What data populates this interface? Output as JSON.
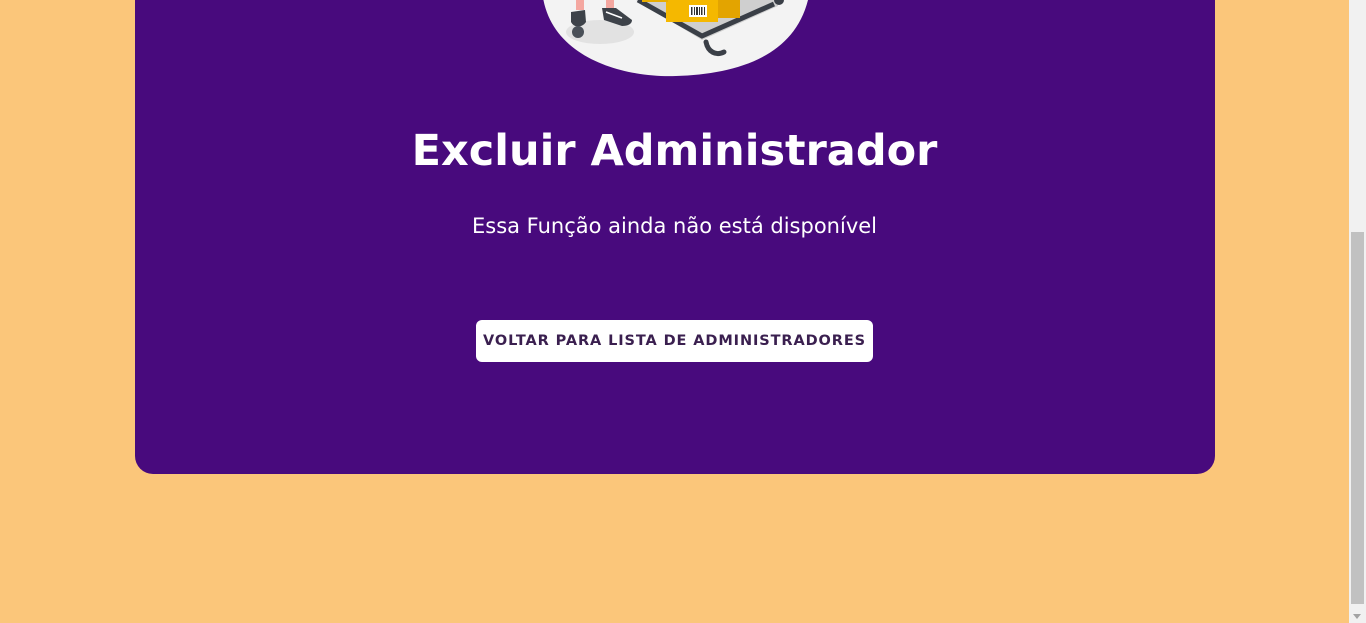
{
  "page": {
    "title": "Excluir Administrador",
    "subtitle": "Essa Função ainda não está disponível",
    "back_button_label": "VOLTAR PARA LISTA DE ADMINISTRADORES"
  },
  "illustration": {
    "icon": "warehouse-worker-illustration"
  },
  "colors": {
    "background": "#fbc67a",
    "card": "#480a7d",
    "button": "#ffffff",
    "button_text": "#3a1f4f"
  },
  "scrollbar": {
    "position_fraction": 0.62
  }
}
